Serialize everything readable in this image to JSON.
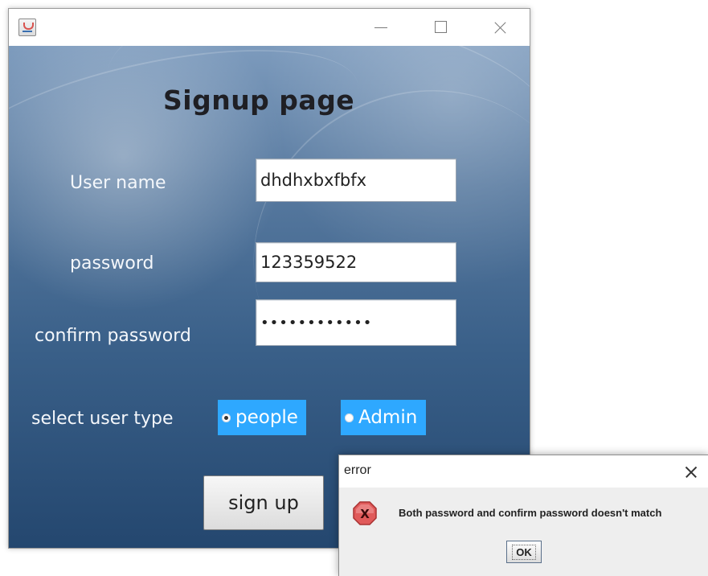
{
  "signup_window": {
    "title": "",
    "heading": "Signup page",
    "fields": {
      "username": {
        "label": "User name",
        "value": "dhdhxbxfbfx"
      },
      "password": {
        "label": "password",
        "value": "123359522"
      },
      "confirm_password": {
        "label": "confirm password",
        "value": "••••••••••••"
      }
    },
    "user_type": {
      "label": "select user type",
      "options": [
        {
          "label": "people",
          "selected": true
        },
        {
          "label": "Admin",
          "selected": false
        }
      ]
    },
    "signup_button": "sign up"
  },
  "error_dialog": {
    "title": "error",
    "icon": "error-x-icon",
    "message": "Both password and confirm password doesn't match",
    "ok_button": "OK"
  },
  "colors": {
    "radio_background": "#2ea8ff",
    "window_gradient_top": "#7d9bbd",
    "window_gradient_bottom": "#24476f",
    "error_icon": "#e05a5a"
  }
}
